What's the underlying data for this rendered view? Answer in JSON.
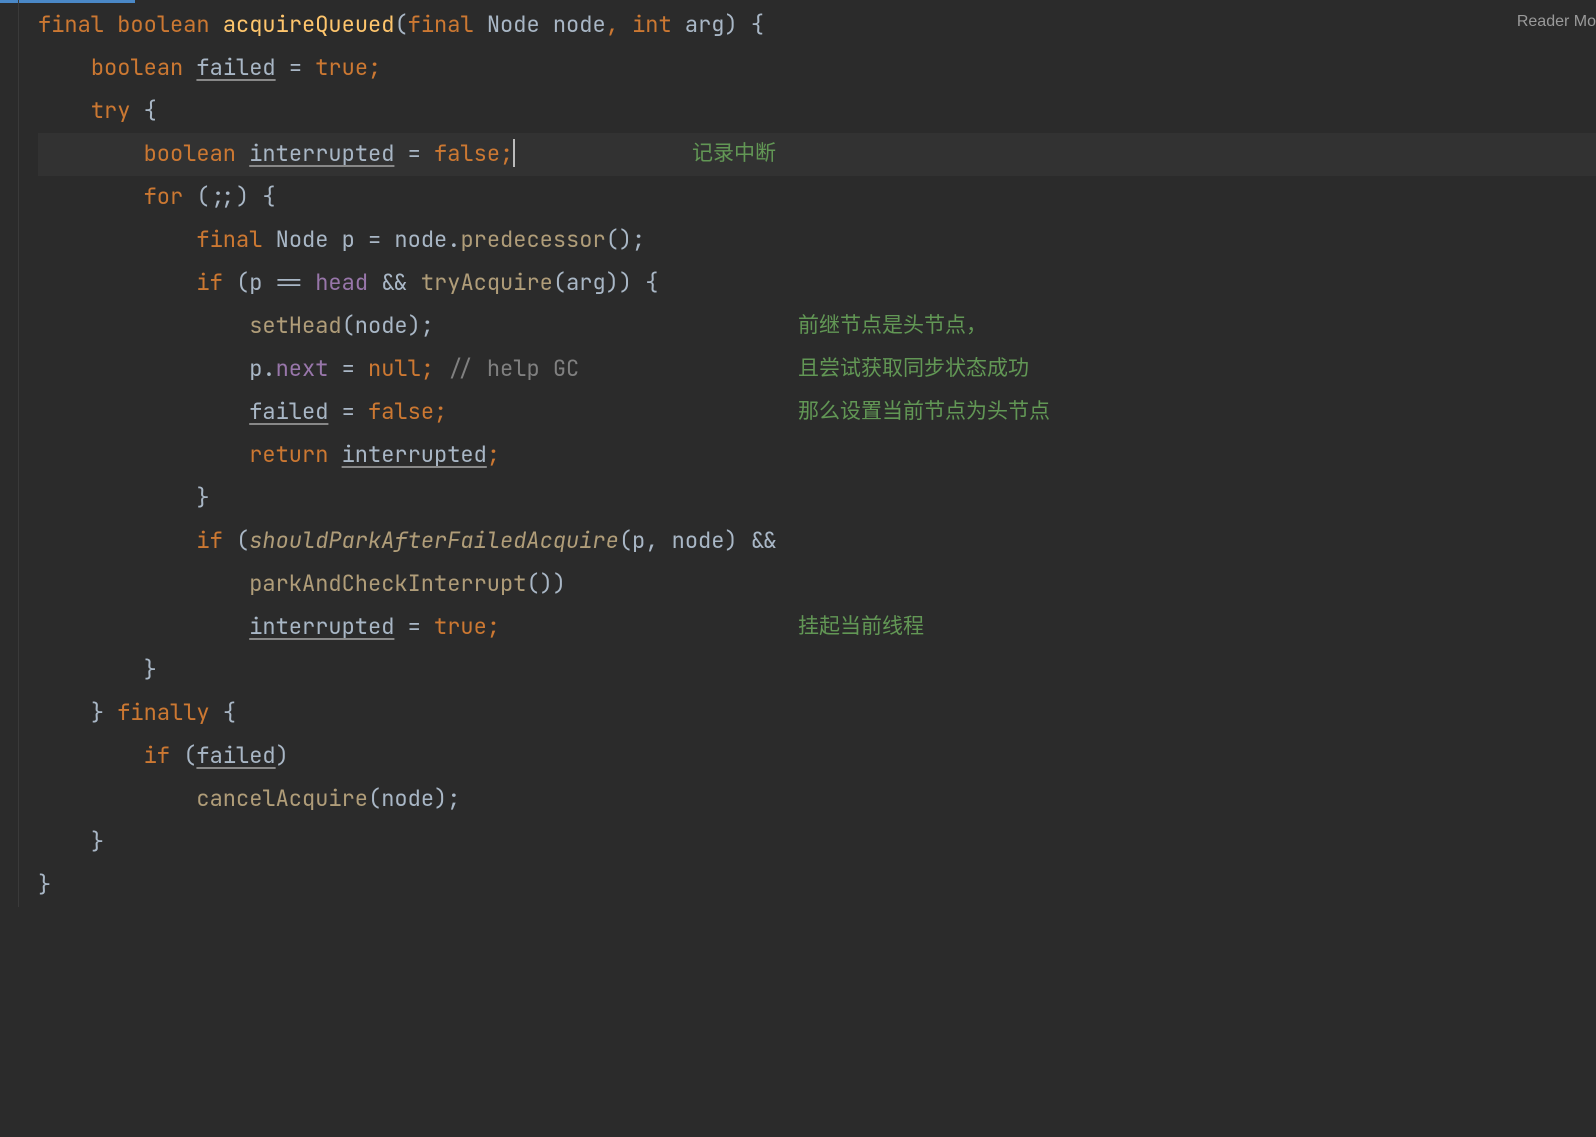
{
  "readerMode": "Reader Mo",
  "annotations": {
    "a1": "记录中断",
    "a2": "前继节点是头节点，",
    "a3": "且尝试获取同步状态成功",
    "a4": "那么设置当前节点为头节点",
    "a5": "挂起当前线程"
  },
  "code": {
    "l1": {
      "final": "final",
      "boolean": "boolean",
      "method": "acquireQueued",
      "p1": "(",
      "final2": "final",
      "node": "Node node",
      "comma": ", ",
      "int": "int",
      "arg": "arg) {"
    },
    "l2": {
      "boolean": "boolean",
      "failed": "failed",
      "eq": " = ",
      "true": "true",
      "semi": ";"
    },
    "l3": {
      "try": "try",
      "brace": " {"
    },
    "l4": {
      "boolean": "boolean",
      "interrupted": "interrupted",
      "eq": " = ",
      "false": "false",
      "semi": ";"
    },
    "l5": {
      "for": "for",
      "rest": " (;;) {"
    },
    "l6": {
      "final": "final",
      "node": " Node ",
      "p": "p = node.",
      "pred": "predecessor",
      "end": "();"
    },
    "l7": {
      "if": "if",
      "open": " (",
      "p": "p == ",
      "head": "head",
      "and": " && ",
      "try": "tryAcquire",
      "close": "(arg)) {"
    },
    "l8": {
      "method": "setHead",
      "rest": "(node);"
    },
    "l9": {
      "p": "p.",
      "next": "next",
      "eq": " = ",
      "null": "null",
      "semi": "; ",
      "comment": "// help GC"
    },
    "l10": {
      "failed": "failed",
      "eq": " = ",
      "false": "false",
      "semi": ";"
    },
    "l11": {
      "return": "return",
      "interrupted": "interrupted",
      "semi": ";"
    },
    "l12": {
      "brace": "}"
    },
    "l13": {
      "if": "if",
      "open": " (",
      "method": "shouldParkAfterFailedAcquire",
      "rest": "(p, node) &&"
    },
    "l14": {
      "method": "parkAndCheckInterrupt",
      "rest": "())"
    },
    "l15": {
      "interrupted": "interrupted",
      "eq": " = ",
      "true": "true",
      "semi": ";"
    },
    "l16": {
      "brace": "}"
    },
    "l17": {
      "close": "} ",
      "finally": "finally",
      "open": " {"
    },
    "l18": {
      "if": "if",
      "open": " (",
      "failed": "failed",
      "close": ")"
    },
    "l19": {
      "method": "cancelAcquire",
      "rest": "(node);"
    },
    "l20": {
      "brace": "}"
    },
    "l21": {
      "brace": "}"
    }
  }
}
